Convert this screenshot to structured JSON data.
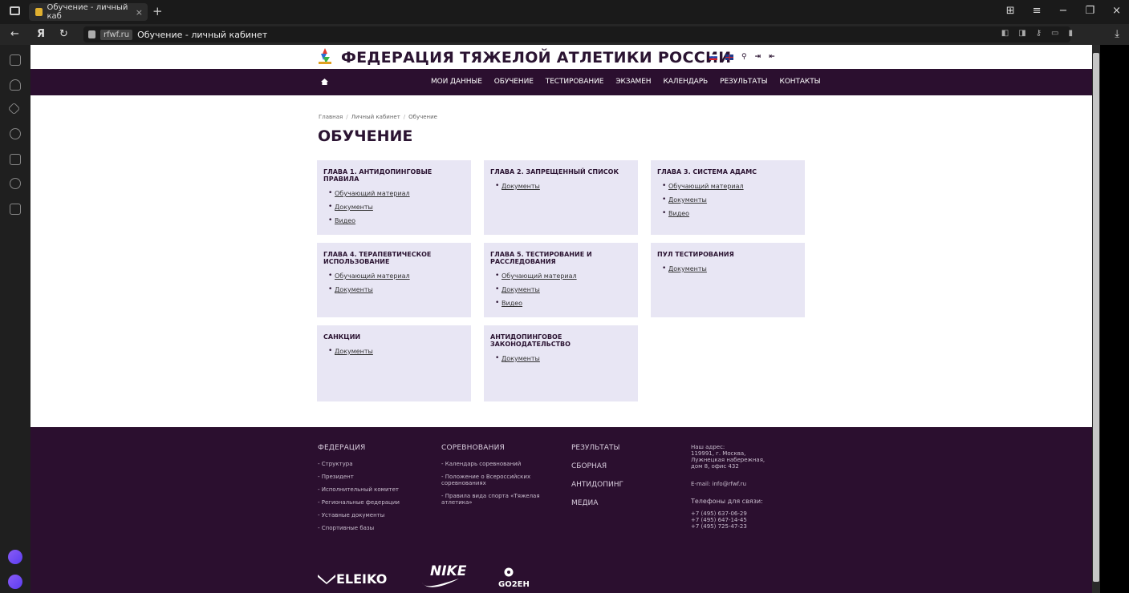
{
  "browser": {
    "tab_title": "Обучение - личный каб",
    "tab_close": "×",
    "new_tab": "+",
    "domain": "rfwf.ru",
    "address_title": "Обучение - личный кабинет",
    "win_minimize": "−",
    "win_close": "×"
  },
  "site": {
    "title": "ФЕДЕРАЦИЯ ТЯЖЕЛОЙ АТЛЕТИКИ РОССИИ",
    "nav": [
      "МОИ ДАННЫЕ",
      "ОБУЧЕНИЕ",
      "ТЕСТИРОВАНИЕ",
      "ЭКЗАМЕН",
      "КАЛЕНДАРЬ",
      "РЕЗУЛЬТАТЫ",
      "КОНТАКТЫ"
    ]
  },
  "breadcrumbs": [
    "Главная",
    "Личный кабинет",
    "Обучение"
  ],
  "page_title": "ОБУЧЕНИЕ",
  "cards": [
    {
      "title": "ГЛАВА 1. АНТИДОПИНГОВЫЕ ПРАВИЛА",
      "links": [
        "Обучающий материал",
        "Документы",
        "Видео"
      ]
    },
    {
      "title": "ГЛАВА 2. ЗАПРЕЩЕННЫЙ СПИСОК",
      "links": [
        "Документы"
      ]
    },
    {
      "title": "ГЛАВА 3. СИСТЕМА АДАМС",
      "links": [
        "Обучающий материал",
        "Документы",
        "Видео"
      ]
    },
    {
      "title": "ГЛАВА 4. ТЕРАПЕВТИЧЕСКОЕ ИСПОЛЬЗОВАНИЕ",
      "links": [
        "Обучающий материал",
        "Документы"
      ]
    },
    {
      "title": "ГЛАВА 5. ТЕСТИРОВАНИЕ И РАССЛЕДОВАНИЯ",
      "links": [
        "Обучающий материал",
        "Документы",
        "Видео"
      ]
    },
    {
      "title": "ПУЛ ТЕСТИРОВАНИЯ",
      "links": [
        "Документы"
      ]
    },
    {
      "title": "САНКЦИИ",
      "links": [
        "Документы"
      ]
    },
    {
      "title": "АНТИДОПИНГОВОЕ ЗАКОНОДАТЕЛЬСТВО",
      "links": [
        "Документы"
      ]
    }
  ],
  "footer": {
    "federation": {
      "heading": "ФЕДЕРАЦИЯ",
      "links": [
        "- Структура",
        "- Президент",
        "- Исполнительный комитет",
        "- Региональные федерации",
        "- Уставные документы",
        "- Спортивные базы"
      ]
    },
    "competitions": {
      "heading": "СОРЕВНОВАНИЯ",
      "links": [
        "- Календарь соревнований",
        "- Положение о Всероссийских соревнованиях",
        "- Правила вида спорта «Тяжелая атлетика»"
      ]
    },
    "sections": [
      "РЕЗУЛЬТАТЫ",
      "СБОРНАЯ",
      "АНТИДОПИНГ",
      "МЕДИА"
    ],
    "contacts": {
      "address": [
        "Наш адрес:",
        "119991, г. Москва,",
        "Лужнецкая набережная,",
        "дом 8, офис 432"
      ],
      "email": "E-mail: info@rfwf.ru",
      "phones_label": "Телефоны для связи:",
      "phones": [
        "+7 (495) 637-06-29",
        "+7 (495) 647-14-45",
        "+7 (495) 725-47-23"
      ]
    },
    "sponsors": [
      "ELEIKO",
      "NIKE",
      "GO2EH"
    ]
  }
}
